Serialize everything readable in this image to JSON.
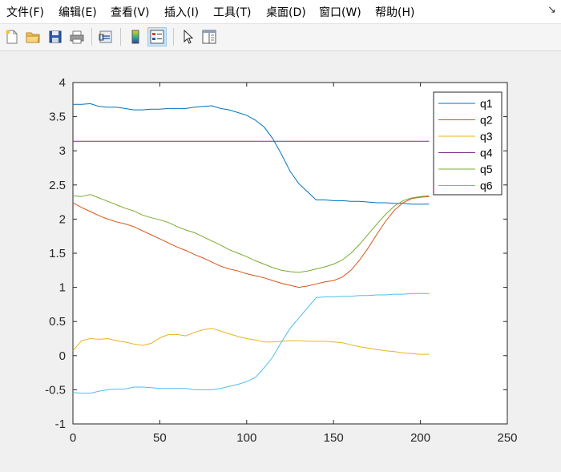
{
  "menu": [
    "文件(F)",
    "编辑(E)",
    "查看(V)",
    "插入(I)",
    "工具(T)",
    "桌面(D)",
    "窗口(W)",
    "帮助(H)"
  ],
  "dock_icon": "arrow-dock-icon",
  "toolbar": {
    "buttons": [
      "new-figure-icon",
      "open-file-icon",
      "save-icon",
      "print-icon",
      "link-plot-icon",
      "colorbar-icon",
      "legend-icon",
      "pointer-icon",
      "property-editor-icon"
    ],
    "active": "legend-icon"
  },
  "chart_data": {
    "type": "line",
    "title": "",
    "xlabel": "",
    "ylabel": "",
    "xlim": [
      0,
      250
    ],
    "ylim": [
      -1,
      4
    ],
    "xticks": [
      "0",
      "50",
      "100",
      "150",
      "200",
      "250"
    ],
    "yticks": [
      "-1",
      "-0.5",
      "0",
      "0.5",
      "1",
      "1.5",
      "2",
      "2.5",
      "3",
      "3.5",
      "4"
    ],
    "grid": false,
    "legend_position": "top-right",
    "x": [
      0,
      5,
      10,
      15,
      20,
      25,
      30,
      35,
      40,
      45,
      50,
      55,
      60,
      65,
      70,
      75,
      80,
      85,
      90,
      95,
      100,
      105,
      110,
      115,
      120,
      125,
      130,
      135,
      140,
      145,
      150,
      155,
      160,
      165,
      170,
      175,
      180,
      185,
      190,
      195,
      200,
      205
    ],
    "series": [
      {
        "name": "q1",
        "color": "#0072bd",
        "values": [
          3.68,
          3.68,
          3.69,
          3.65,
          3.64,
          3.64,
          3.62,
          3.6,
          3.6,
          3.61,
          3.61,
          3.62,
          3.62,
          3.62,
          3.64,
          3.65,
          3.66,
          3.62,
          3.6,
          3.56,
          3.52,
          3.45,
          3.35,
          3.18,
          2.95,
          2.7,
          2.52,
          2.4,
          2.28,
          2.28,
          2.27,
          2.27,
          2.26,
          2.26,
          2.25,
          2.24,
          2.24,
          2.23,
          2.23,
          2.22,
          2.22,
          2.22
        ]
      },
      {
        "name": "q2",
        "color": "#d95319",
        "values": [
          2.24,
          2.17,
          2.11,
          2.05,
          2.0,
          1.96,
          1.93,
          1.89,
          1.83,
          1.77,
          1.71,
          1.65,
          1.59,
          1.54,
          1.48,
          1.43,
          1.37,
          1.31,
          1.27,
          1.24,
          1.2,
          1.17,
          1.14,
          1.1,
          1.06,
          1.03,
          1.0,
          1.02,
          1.05,
          1.08,
          1.1,
          1.15,
          1.25,
          1.4,
          1.58,
          1.78,
          1.97,
          2.13,
          2.24,
          2.3,
          2.32,
          2.33
        ]
      },
      {
        "name": "q3",
        "color": "#edb120",
        "values": [
          0.07,
          0.22,
          0.25,
          0.24,
          0.25,
          0.22,
          0.2,
          0.17,
          0.15,
          0.18,
          0.26,
          0.31,
          0.31,
          0.29,
          0.34,
          0.38,
          0.4,
          0.36,
          0.32,
          0.28,
          0.25,
          0.23,
          0.2,
          0.2,
          0.21,
          0.22,
          0.22,
          0.21,
          0.21,
          0.21,
          0.2,
          0.19,
          0.16,
          0.13,
          0.11,
          0.09,
          0.07,
          0.06,
          0.04,
          0.03,
          0.02,
          0.02
        ]
      },
      {
        "name": "q4",
        "color": "#7e2f8e",
        "values": [
          3.14,
          3.14,
          3.14,
          3.14,
          3.14,
          3.14,
          3.14,
          3.14,
          3.14,
          3.14,
          3.14,
          3.14,
          3.14,
          3.14,
          3.14,
          3.14,
          3.14,
          3.14,
          3.14,
          3.14,
          3.14,
          3.14,
          3.14,
          3.14,
          3.14,
          3.14,
          3.14,
          3.14,
          3.14,
          3.14,
          3.14,
          3.14,
          3.14,
          3.14,
          3.14,
          3.14,
          3.14,
          3.14,
          3.14,
          3.14,
          3.14,
          3.14
        ]
      },
      {
        "name": "q5",
        "color": "#77ac30",
        "values": [
          2.34,
          2.33,
          2.36,
          2.31,
          2.26,
          2.21,
          2.16,
          2.12,
          2.06,
          2.02,
          1.99,
          1.95,
          1.89,
          1.84,
          1.8,
          1.74,
          1.68,
          1.62,
          1.55,
          1.5,
          1.45,
          1.39,
          1.34,
          1.29,
          1.25,
          1.23,
          1.22,
          1.24,
          1.27,
          1.3,
          1.34,
          1.4,
          1.5,
          1.63,
          1.78,
          1.93,
          2.07,
          2.19,
          2.27,
          2.31,
          2.33,
          2.34
        ]
      },
      {
        "name": "q6",
        "color": "#4dbeee",
        "values": [
          -0.54,
          -0.55,
          -0.55,
          -0.52,
          -0.5,
          -0.49,
          -0.49,
          -0.46,
          -0.46,
          -0.47,
          -0.48,
          -0.48,
          -0.48,
          -0.48,
          -0.5,
          -0.5,
          -0.5,
          -0.48,
          -0.45,
          -0.42,
          -0.38,
          -0.32,
          -0.18,
          -0.02,
          0.2,
          0.4,
          0.55,
          0.7,
          0.85,
          0.86,
          0.86,
          0.87,
          0.87,
          0.88,
          0.88,
          0.89,
          0.89,
          0.9,
          0.9,
          0.91,
          0.91,
          0.91
        ]
      }
    ]
  }
}
